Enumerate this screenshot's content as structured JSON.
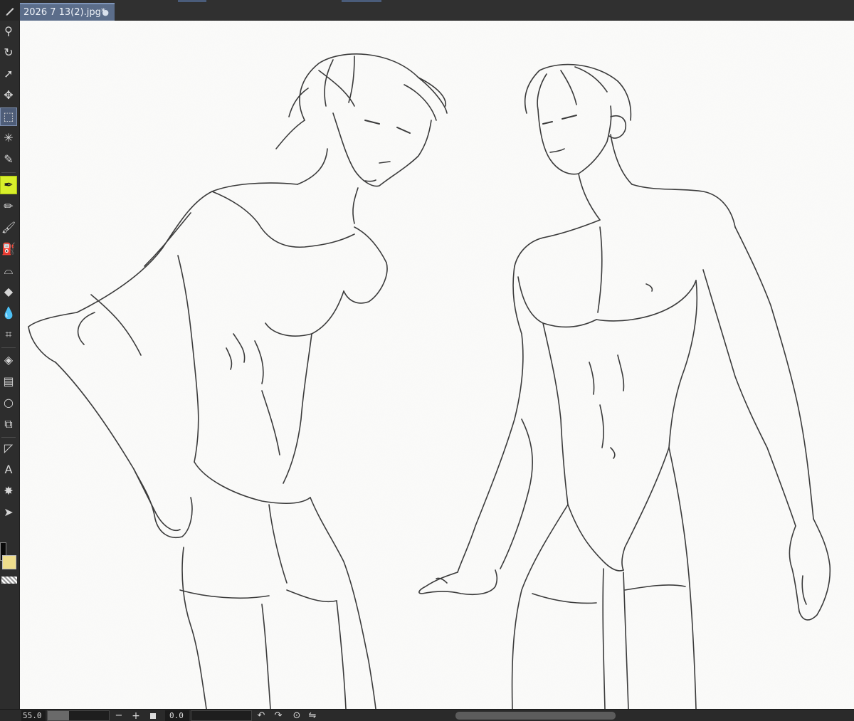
{
  "document": {
    "tab_title": "2026 7 13(2).jpg*",
    "unsaved_marker": "●"
  },
  "toolbar": {
    "tools": [
      {
        "name": "zoom-tool",
        "glyph": "⚲"
      },
      {
        "name": "rotate-view-tool",
        "glyph": "↻"
      },
      {
        "name": "operation-tool",
        "glyph": "➚"
      },
      {
        "name": "move-layer-tool",
        "glyph": "✥"
      },
      {
        "name": "selection-tool",
        "glyph": "⬚"
      },
      {
        "name": "auto-select-tool",
        "glyph": "✳"
      },
      {
        "name": "eyedropper-tool",
        "glyph": "✎"
      },
      {
        "name": "pen-tool",
        "glyph": "✒"
      },
      {
        "name": "pencil-tool",
        "glyph": "✏"
      },
      {
        "name": "brush-tool",
        "glyph": "🖌"
      },
      {
        "name": "airbrush-tool",
        "glyph": "⛽"
      },
      {
        "name": "decoration-tool",
        "glyph": "⌓"
      },
      {
        "name": "eraser-tool",
        "glyph": "◆"
      },
      {
        "name": "blend-tool",
        "glyph": "💧"
      },
      {
        "name": "perspective-tool",
        "glyph": "⌗"
      },
      {
        "name": "fill-tool",
        "glyph": "◈"
      },
      {
        "name": "gradient-tool",
        "glyph": "▤"
      },
      {
        "name": "figure-tool",
        "glyph": "○"
      },
      {
        "name": "frame-border-tool",
        "glyph": "⧉"
      },
      {
        "name": "ruler-tool",
        "glyph": "◸"
      },
      {
        "name": "text-tool",
        "glyph": "A"
      },
      {
        "name": "balloon-tool",
        "glyph": "✸"
      },
      {
        "name": "correct-line-tool",
        "glyph": "➤"
      }
    ],
    "active_tool": "selection-tool",
    "current_drawing_tool": "pen-tool"
  },
  "colors": {
    "main": "#0a0a0a",
    "sub": "#eedd8c"
  },
  "statusbar": {
    "zoom": "55.0",
    "zoom_out_label": "−",
    "zoom_in_label": "+",
    "angle": "0.0",
    "rotate_left": "↶",
    "rotate_right": "↷",
    "reset_rotation": "⊙",
    "flip": "⇋"
  }
}
